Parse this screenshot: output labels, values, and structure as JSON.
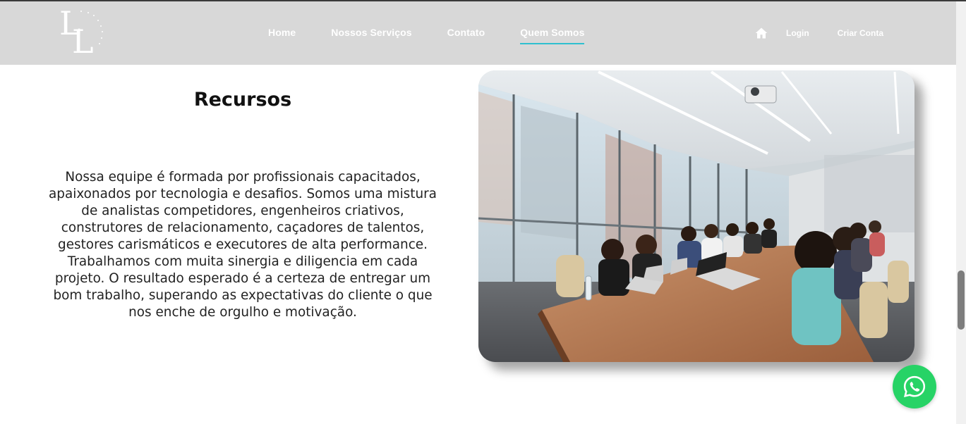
{
  "header": {
    "logo_letter_1": "L",
    "logo_letter_2": "L",
    "nav": {
      "home": "Home",
      "servicos": "Nossos Serviços",
      "contato": "Contato",
      "quem_somos": "Quem Somos"
    },
    "login": "Login",
    "criar_conta": "Criar Conta"
  },
  "main": {
    "title": "Recursos",
    "paragraph": "Nossa equipe é formada por profissionais capacitados, apaixonados por tecnologia e desafios. Somos uma mistura de analistas competidores, engenheiros criativos, construtores de relacionamento, caçadores de talentos, gestores carismáticos e executores de alta performance. Trabalhamos com muita sinergia e diligencia em cada projeto. O resultado esperado é a certeza de entregar um bom trabalho, superando as expectativas do cliente o que nos enche de orgulho e motivação."
  },
  "icons": {
    "home": "home-icon",
    "whatsapp": "whatsapp-icon"
  },
  "colors": {
    "header_bg": "#d8d8d8",
    "active_underline": "#2fc0cf",
    "whatsapp": "#27d366"
  }
}
